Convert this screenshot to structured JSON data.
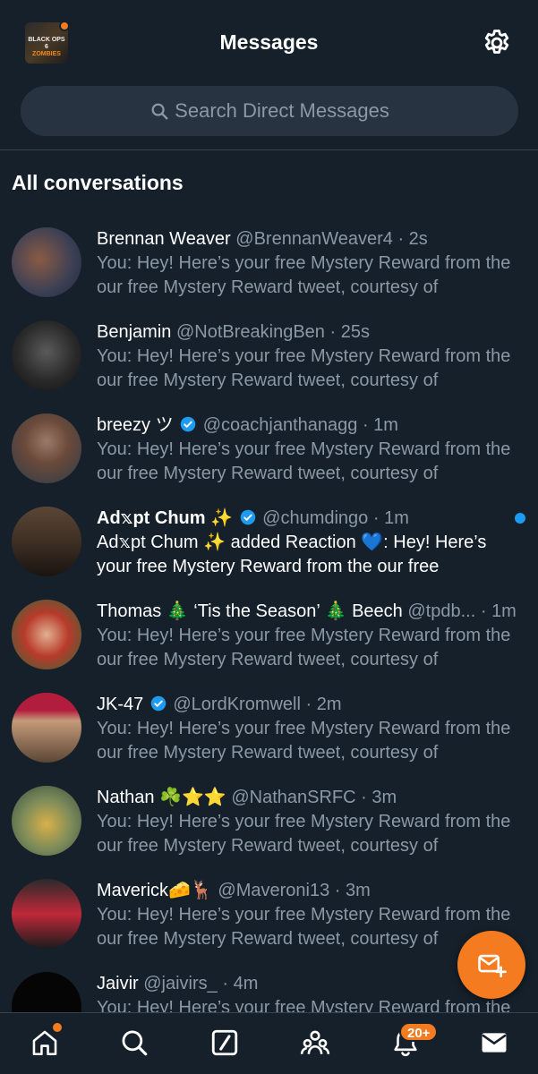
{
  "header": {
    "title": "Messages",
    "avatar_logo_line1": "BLACK OPS 6",
    "avatar_logo_line2": "ZOMBIES",
    "settings_icon": "gear-icon"
  },
  "search": {
    "placeholder": "Search Direct Messages"
  },
  "section_title": "All conversations",
  "conversations": [
    {
      "name": "Brennan Weaver",
      "handle": "@BrennanWeaver4",
      "time": "2s",
      "verified": false,
      "preview_line1": "You: Hey! Here’s your free Mystery Reward from the",
      "preview_line2": "our free Mystery Reward tweet, courtesy of",
      "avatar_colors": [
        "#3a3f55",
        "#8a5a44"
      ]
    },
    {
      "name": "Benjamin",
      "handle": "@NotBreakingBen",
      "time": "25s",
      "verified": false,
      "preview_line1": "You: Hey! Here’s your free Mystery Reward from the",
      "preview_line2": "our free Mystery Reward tweet, courtesy of",
      "avatar_colors": [
        "#1d1d1d",
        "#4d4d4d"
      ]
    },
    {
      "name": "breezy ツ",
      "handle": "@coachjanthanagg",
      "time": "1m",
      "verified": true,
      "preview_line1": "You: Hey! Here’s your free Mystery Reward from the",
      "preview_line2": "our free Mystery Reward tweet, courtesy of",
      "avatar_colors": [
        "#6b4a3a",
        "#2f3a4a"
      ]
    },
    {
      "name": "Ad𝕩pt Chum ✨",
      "handle": "@chumdingo",
      "time": "1m",
      "verified": true,
      "unread": true,
      "preview_line1": "Ad𝕩pt Chum ✨ added Reaction 💙: Hey! Here’s",
      "preview_line2": "your free Mystery Reward from the our free",
      "avatar_colors": [
        "#3e2f24",
        "#1a1410"
      ]
    },
    {
      "name": "Thomas 🎄 ‘Tis the Season’ 🎄 Beech",
      "handle": "@tpdb...",
      "time": "1m",
      "verified": false,
      "preview_line1": "You: Hey! Here’s your free Mystery Reward from the",
      "preview_line2": "our free Mystery Reward tweet, courtesy of",
      "avatar_colors": [
        "#2d6a3a",
        "#b83a2a"
      ]
    },
    {
      "name": "JK-47",
      "handle": "@LordKromwell",
      "time": "2m",
      "verified": true,
      "preview_line1": "You: Hey! Here’s your free Mystery Reward from the",
      "preview_line2": "our free Mystery Reward tweet, courtesy of",
      "avatar_colors": [
        "#b31d3d",
        "#5c4636"
      ]
    },
    {
      "name": "Nathan ☘️⭐⭐",
      "handle": "@NathanSRFC",
      "time": "3m",
      "verified": false,
      "preview_line1": "You: Hey! Here’s your free Mystery Reward from the",
      "preview_line2": "our free Mystery Reward tweet, courtesy of",
      "avatar_colors": [
        "#7a8a5a",
        "#d8b04a"
      ]
    },
    {
      "name": "Maverick🧀🦌",
      "handle": "@Maveroni13",
      "time": "3m",
      "verified": false,
      "preview_line1": "You: Hey! Here’s your free Mystery Reward from the",
      "preview_line2": "our free Mystery Reward tweet, courtesy of",
      "avatar_colors": [
        "#c0283a",
        "#1b1b1b"
      ]
    },
    {
      "name": "Jaivir",
      "handle": "@jaivirs_",
      "time": "4m",
      "verified": false,
      "preview_line1": "You: Hey! Here’s your free Mystery Reward from the",
      "preview_line2": "",
      "avatar_colors": [
        "#050505",
        "#0c0c0c"
      ]
    }
  ],
  "fab": {
    "icon": "new-message-icon"
  },
  "bottom_nav": {
    "home_icon": "home-icon",
    "search_icon": "search-icon",
    "grok_icon": "grok-icon",
    "communities_icon": "communities-icon",
    "notifications_icon": "bell-icon",
    "notifications_badge": "20+",
    "messages_icon": "envelope-icon"
  },
  "colors": {
    "background": "#15202b",
    "accent": "#f47b20",
    "verified": "#1d9bf0",
    "muted_text": "#8b98a5",
    "search_bg": "#273340"
  }
}
